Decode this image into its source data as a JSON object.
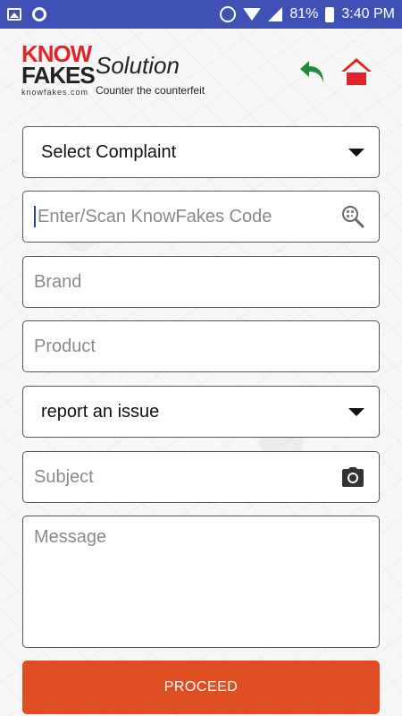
{
  "status_bar": {
    "battery": "81%",
    "time": "3:40 PM",
    "icons": [
      "image-icon",
      "circle-icon",
      "alarm-icon",
      "wifi-icon",
      "signal-icon",
      "battery-charging-icon"
    ]
  },
  "header": {
    "logo_line1": "KNOW",
    "logo_line2": "FAKES",
    "logo_url": "knowfakes.com",
    "title": "Solution",
    "tagline": "Counter the counterfeit",
    "back_icon": "back-arrow-icon",
    "home_icon": "home-icon"
  },
  "form": {
    "complaint_select": "Select Complaint",
    "code_input_placeholder": "Enter/Scan KnowFakes Code",
    "brand_placeholder": "Brand",
    "product_placeholder": "Product",
    "issue_select": "report an issue",
    "subject_placeholder": "Subject",
    "message_placeholder": "Message",
    "proceed_label": "PROCEED"
  },
  "colors": {
    "status_bar": "#3f51b5",
    "accent_red": "#e0252a",
    "back_green": "#1f8a3c",
    "proceed": "#e04e23"
  }
}
